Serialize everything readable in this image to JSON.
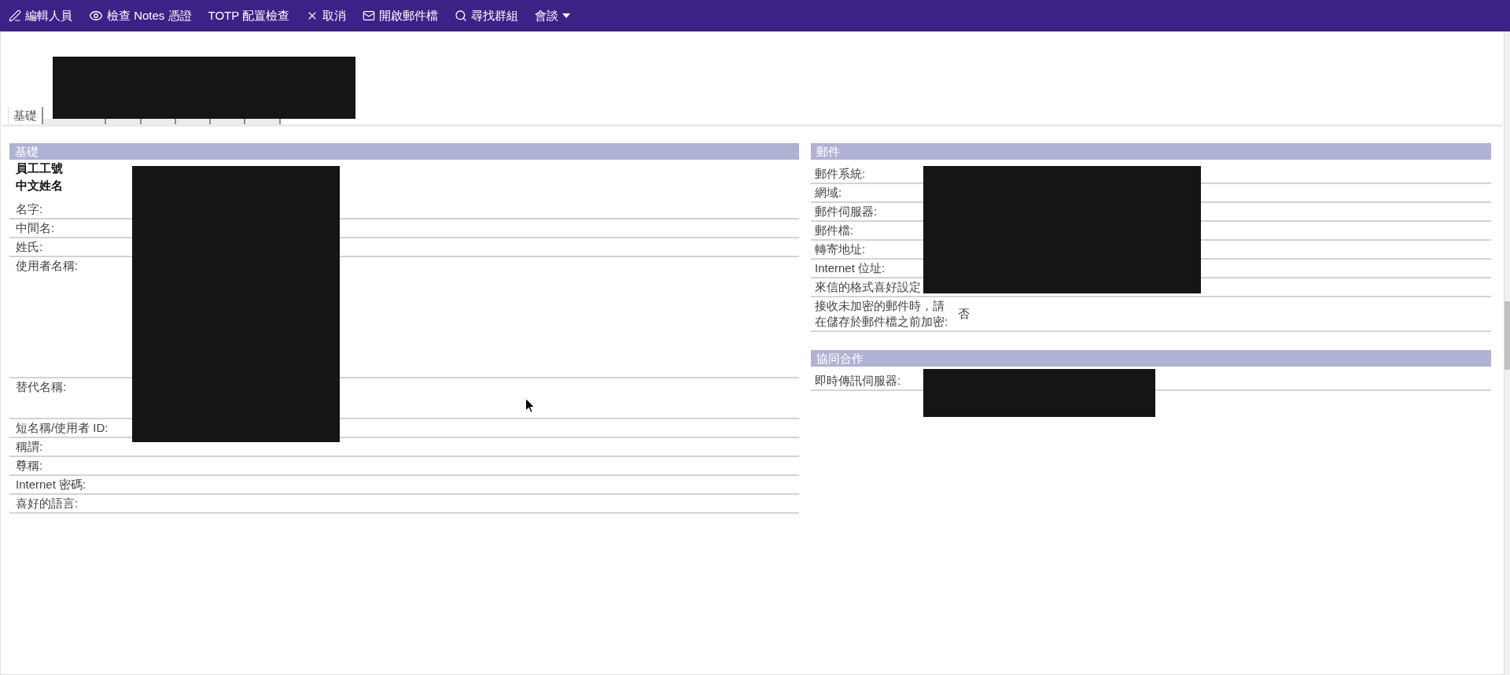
{
  "toolbar": {
    "items": [
      {
        "kind": "edit",
        "label": "編輯人員"
      },
      {
        "kind": "inspect",
        "label": "檢查 Notes 憑證"
      },
      {
        "kind": "plain",
        "label": "TOTP 配置檢查"
      },
      {
        "kind": "cancel",
        "label": "取消"
      },
      {
        "kind": "mail",
        "label": "開啟郵件檔"
      },
      {
        "kind": "find",
        "label": "尋找群組"
      },
      {
        "kind": "menu",
        "label": "會談"
      }
    ]
  },
  "header": {
    "redacted": true
  },
  "tabs": [
    {
      "label": "基礎",
      "selected": true
    },
    {
      "selected": false
    },
    {
      "selected": false
    },
    {
      "selected": false
    },
    {
      "selected": false
    },
    {
      "selected": false
    },
    {
      "selected": false
    }
  ],
  "left_column": {
    "sections": [
      {
        "title": "基礎",
        "redacted": true,
        "rows": [
          {
            "kind": "heading",
            "label": "員工工號"
          },
          {
            "kind": "heading",
            "label": "中文姓名"
          },
          {
            "kind": "single",
            "label": "名字:"
          },
          {
            "kind": "single",
            "label": "中間名:"
          },
          {
            "kind": "single",
            "label": "姓氏:"
          },
          {
            "kind": "tall",
            "label": "使用者名稱:"
          },
          {
            "kind": "double",
            "label": "替代名稱:"
          },
          {
            "kind": "single",
            "label": "短名稱/使用者 ID:"
          },
          {
            "kind": "single",
            "label": "稱謂:"
          },
          {
            "kind": "single",
            "label": "尊稱:"
          },
          {
            "kind": "single",
            "label": "Internet 密碼:"
          },
          {
            "kind": "single",
            "label": "喜好的語言:"
          }
        ]
      }
    ]
  },
  "right_column": {
    "sections": [
      {
        "title": "郵件",
        "redacted": true,
        "rows": [
          {
            "kind": "single",
            "label": "郵件系統:"
          },
          {
            "kind": "single",
            "label": "網域:"
          },
          {
            "kind": "single",
            "label": "郵件伺服器:"
          },
          {
            "kind": "single",
            "label": "郵件檔:"
          },
          {
            "kind": "single",
            "label": "轉寄地址:"
          },
          {
            "kind": "single",
            "label": "Internet 位址:"
          },
          {
            "kind": "single",
            "label": "來信的格式喜好設定"
          },
          {
            "kind": "single",
            "label": "接收未加密的郵件時，請在儲存於郵件檔之前加密:",
            "value": "否"
          }
        ]
      },
      {
        "title": "協同合作",
        "redacted": true,
        "rows": [
          {
            "kind": "single",
            "label": "即時傳訊伺服器:"
          }
        ]
      }
    ]
  }
}
